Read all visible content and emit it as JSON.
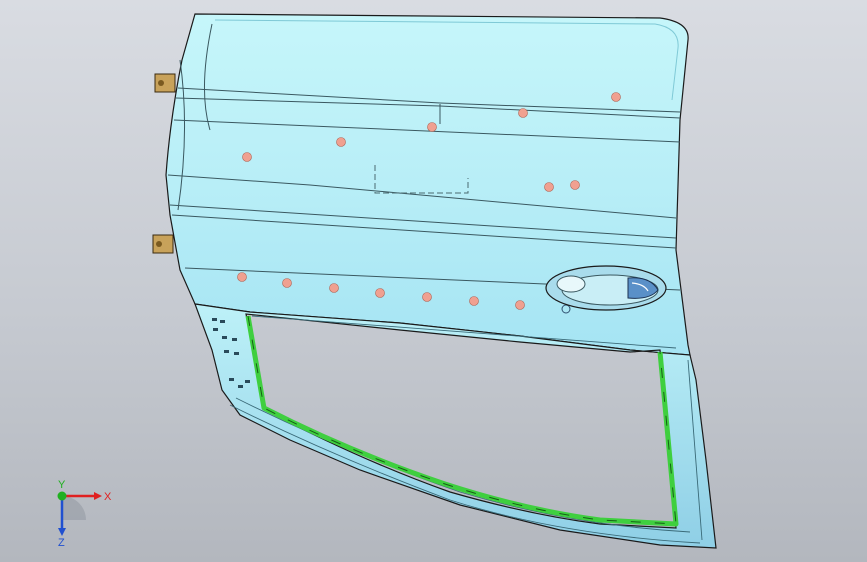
{
  "viewport": {
    "model": "door-panel",
    "colors": {
      "background_top": "#d9dce2",
      "background_bottom": "#b3b7be",
      "panel_fill": "#bff3f8",
      "panel_fill_light": "#d9fbfd",
      "panel_edge": "#1a1a1a",
      "hole_marker": "#f0a090",
      "weatherstrip": "#3fcf3f",
      "bracket": "#c8a25a"
    }
  },
  "triad": {
    "x_label": "X",
    "y_label": "Y",
    "z_label": "Z",
    "colors": {
      "x": "#e02020",
      "y": "#20b020",
      "z": "#2050d0"
    }
  }
}
